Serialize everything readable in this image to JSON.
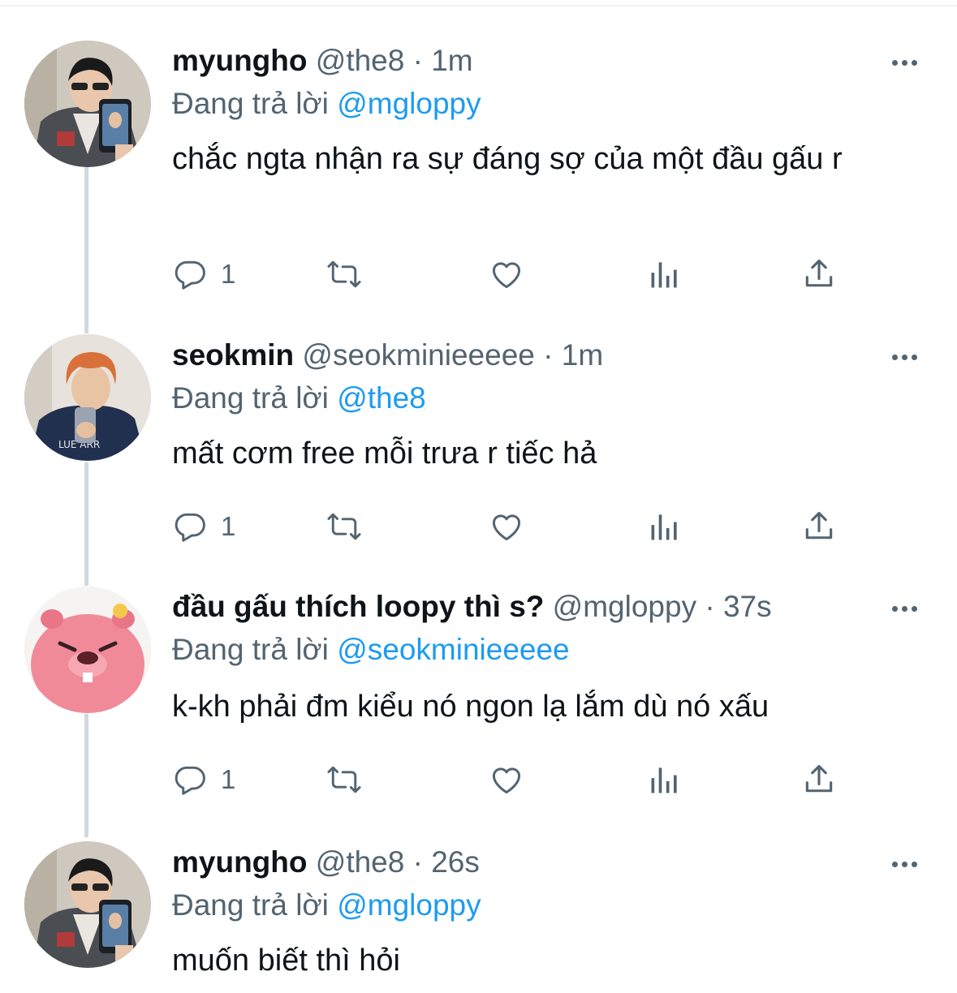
{
  "colors": {
    "text": "#0f1419",
    "muted": "#536471",
    "link": "#1d9bf0",
    "thread": "#cfd9de"
  },
  "tweets": [
    {
      "name": "myungho",
      "handle": "@the8",
      "dot": " · ",
      "time": "1m",
      "reply_prefix": "Đang trả lời ",
      "reply_to": "@mgloppy",
      "text": "chắc ngta nhận ra sự đáng sợ của một đầu gấu r",
      "reply_count": "1",
      "avatar": "selfie-dark-jacket"
    },
    {
      "name": "seokmin",
      "handle": "@seokminieeeee",
      "dot": " · ",
      "time": "1m",
      "reply_prefix": "Đang trả lời ",
      "reply_to": "@the8",
      "text": "mất cơm free mỗi trưa r tiếc hả",
      "reply_count": "1",
      "avatar": "selfie-orange-hair-navy-hoodie"
    },
    {
      "name": "đầu gấu thích loopy thì s?",
      "handle": "@mgloppy",
      "dot": " · ",
      "time": "37s",
      "reply_prefix": "Đang trả lời ",
      "reply_to": "@seokminieeeee",
      "text": "k-kh phải đm kiểu nó ngon lạ lắm dù nó xấu",
      "reply_count": "1",
      "avatar": "pink-beaver-loopy"
    },
    {
      "name": "myungho",
      "handle": "@the8",
      "dot": " · ",
      "time": "26s",
      "reply_prefix": "Đang trả lời ",
      "reply_to": "@mgloppy",
      "text": "muốn biết thì hỏi",
      "reply_count": "",
      "avatar": "selfie-dark-jacket"
    }
  ],
  "icons": {
    "reply": "reply-bubble-icon",
    "retweet": "retweet-icon",
    "like": "heart-icon",
    "views": "analytics-bars-icon",
    "share": "share-upload-icon",
    "more": "more-dots-icon"
  }
}
